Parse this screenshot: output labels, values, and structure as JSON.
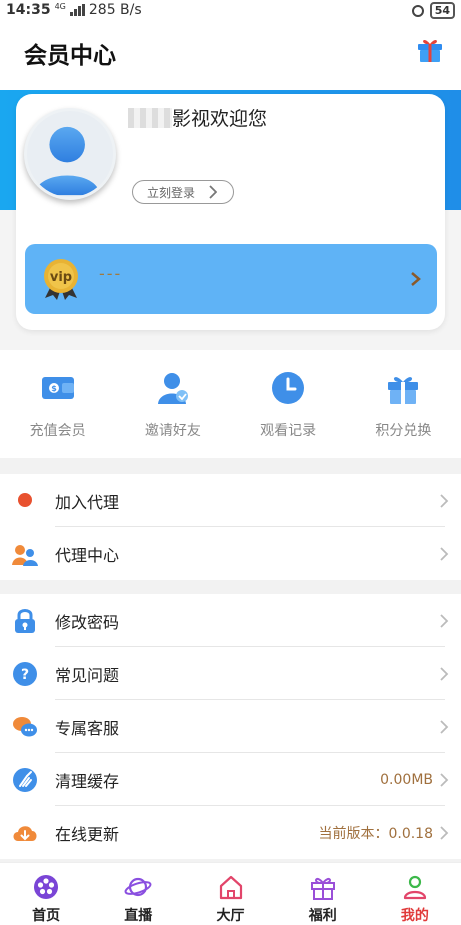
{
  "status_bar": {
    "time": "14:35",
    "net_type": "4G",
    "speed": "285 B/s",
    "battery": "54"
  },
  "header": {
    "title": "会员中心"
  },
  "profile": {
    "welcome": "影视欢迎您",
    "login_label": "立刻登录",
    "vip_text": "---"
  },
  "quick_actions": [
    {
      "label": "充值会员",
      "icon": "wallet-icon"
    },
    {
      "label": "邀请好友",
      "icon": "invite-friend-icon"
    },
    {
      "label": "观看记录",
      "icon": "clock-icon"
    },
    {
      "label": "积分兑换",
      "icon": "gift-icon"
    }
  ],
  "menu_group_1": [
    {
      "label": "加入代理",
      "icon": "red-dot-icon"
    },
    {
      "label": "代理中心",
      "icon": "users-icon"
    }
  ],
  "menu_group_2": [
    {
      "label": "修改密码",
      "icon": "lock-icon"
    },
    {
      "label": "常见问题",
      "icon": "question-icon"
    },
    {
      "label": "专属客服",
      "icon": "chat-bubbles-icon"
    },
    {
      "label": "清理缓存",
      "icon": "broom-icon",
      "value": "0.00MB"
    },
    {
      "label": "在线更新",
      "icon": "cloud-download-icon",
      "value": "当前版本：0.0.18"
    }
  ],
  "bottom_nav": [
    {
      "label": "首页",
      "icon": "film-reel-icon"
    },
    {
      "label": "直播",
      "icon": "planet-icon"
    },
    {
      "label": "大厅",
      "icon": "house-icon"
    },
    {
      "label": "福利",
      "icon": "gift-icon"
    },
    {
      "label": "我的",
      "icon": "person-icon",
      "active": true
    }
  ],
  "colors": {
    "accent_blue": "#1f8ee8",
    "vip_bar": "#5fb3f6",
    "active_red": "#e03a3a",
    "value_brown": "#a0703e"
  }
}
